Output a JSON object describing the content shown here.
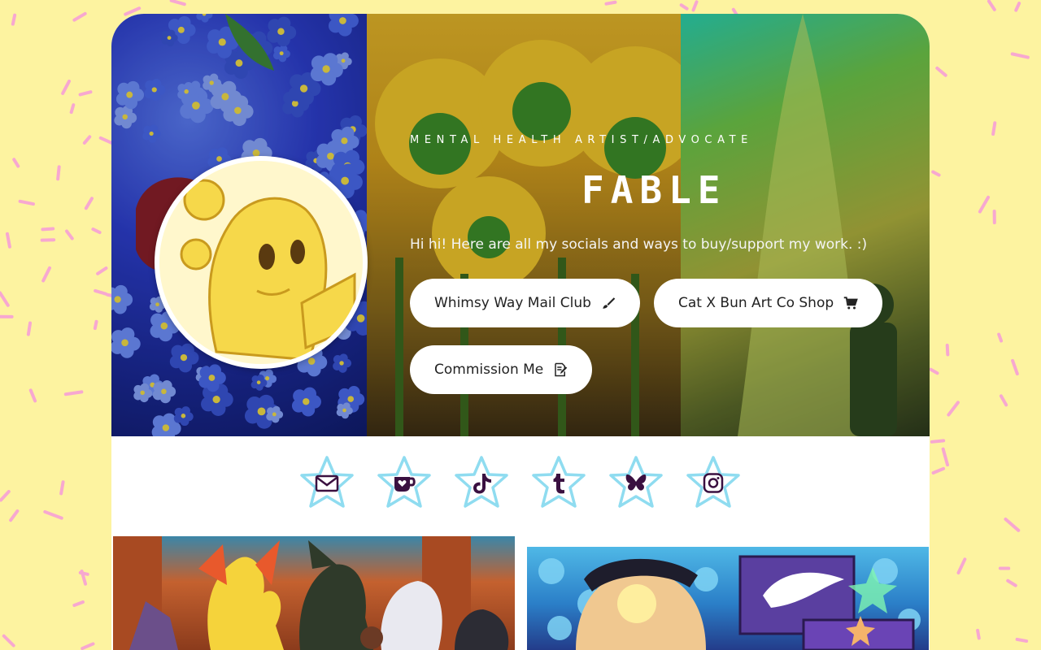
{
  "profile": {
    "tagline": "MENTAL HEALTH ARTIST/ADVOCATE",
    "name": "FABLE",
    "bio": "Hi hi! Here are all my socials and ways to buy/support my work. :)"
  },
  "links": [
    {
      "label": "Whimsy Way Mail Club",
      "icon": "paintbrush-icon"
    },
    {
      "label": "Cat X Bun Art Co Shop",
      "icon": "shopping-cart-icon"
    },
    {
      "label": "Commission Me",
      "icon": "edit-document-icon"
    }
  ],
  "socials": [
    {
      "name": "email",
      "icon": "envelope-icon"
    },
    {
      "name": "kofi",
      "icon": "kofi-cup-icon"
    },
    {
      "name": "tiktok",
      "icon": "tiktok-icon"
    },
    {
      "name": "tumblr",
      "icon": "tumblr-icon"
    },
    {
      "name": "bluesky",
      "icon": "butterfly-icon"
    },
    {
      "name": "instagram",
      "icon": "instagram-icon"
    }
  ],
  "colors": {
    "background": "#fdf3a0",
    "sprinkles": "#f7a8d0",
    "star_fill": "#ffffff",
    "star_outline": "#8fdcf0",
    "social_icon": "#3a1040",
    "pill_background": "#ffffff",
    "pill_text": "#222222"
  }
}
